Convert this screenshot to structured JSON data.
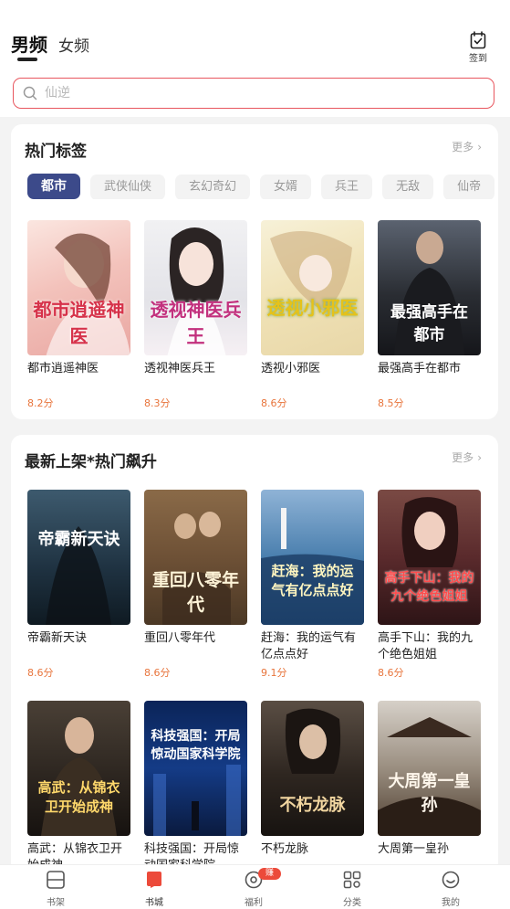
{
  "header": {
    "tabs": [
      {
        "label": "男频",
        "active": true
      },
      {
        "label": "女频",
        "active": false
      }
    ],
    "checkin_label": "签到",
    "checkin_icon": "calendar-check-icon"
  },
  "search": {
    "placeholder": "仙逆",
    "icon": "search-icon"
  },
  "hot_tags": {
    "title": "热门标签",
    "more_label": "更多",
    "tags": [
      "都市",
      "武侠仙侠",
      "玄幻奇幻",
      "女婿",
      "兵王",
      "无敌",
      "仙帝"
    ],
    "active_tag": "都市",
    "books": [
      {
        "name": "都市逍遥神医",
        "rating": "8.2分",
        "cover_text": "都市逍遥神医"
      },
      {
        "name": "透视神医兵王",
        "rating": "8.3分",
        "cover_text": "透视神医兵王"
      },
      {
        "name": "透视小邪医",
        "rating": "8.6分",
        "cover_text": "透视小邪医"
      },
      {
        "name": "最强高手在都市",
        "rating": "8.5分",
        "cover_text": "最强高手在都市"
      }
    ]
  },
  "latest": {
    "title": "最新上架*热门飙升",
    "more_label": "更多",
    "books": [
      {
        "name": "帝霸新天诀",
        "rating": "8.6分",
        "cover_text": "帝霸新天诀"
      },
      {
        "name": "重回八零年代",
        "rating": "8.6分",
        "cover_text": "重回八零年代"
      },
      {
        "name": "赶海：我的运气有亿点点好",
        "rating": "9.1分",
        "cover_text": "赶海：我的运气有亿点点好"
      },
      {
        "name": "高手下山：我的九个绝色姐姐",
        "rating": "8.6分",
        "cover_text": "高手下山：我的九个绝色姐姐"
      },
      {
        "name": "高武：从锦衣卫开始成神",
        "rating": "",
        "cover_text": "高武：从锦衣卫开始成神"
      },
      {
        "name": "科技强国：开局惊动国家科学院",
        "rating": "",
        "cover_text": "科技强国：开局惊动国家科学院"
      },
      {
        "name": "不朽龙脉",
        "rating": "",
        "cover_text": "不朽龙脉"
      },
      {
        "name": "大周第一皇孙",
        "rating": "",
        "cover_text": "大周第一皇孙"
      }
    ]
  },
  "bottom_nav": {
    "items": [
      {
        "label": "书架",
        "icon": "bookshelf-icon"
      },
      {
        "label": "书城",
        "icon": "bookstore-icon",
        "active": true
      },
      {
        "label": "福利",
        "icon": "welfare-icon",
        "badge": "赚钱"
      },
      {
        "label": "分类",
        "icon": "category-icon"
      },
      {
        "label": "我的",
        "icon": "profile-icon"
      }
    ]
  },
  "colors": {
    "accent_red": "#e8565e",
    "active_tag_bg": "#3c4a8a",
    "rating_orange": "#e8743b",
    "badge_red": "#ec4a3a"
  }
}
